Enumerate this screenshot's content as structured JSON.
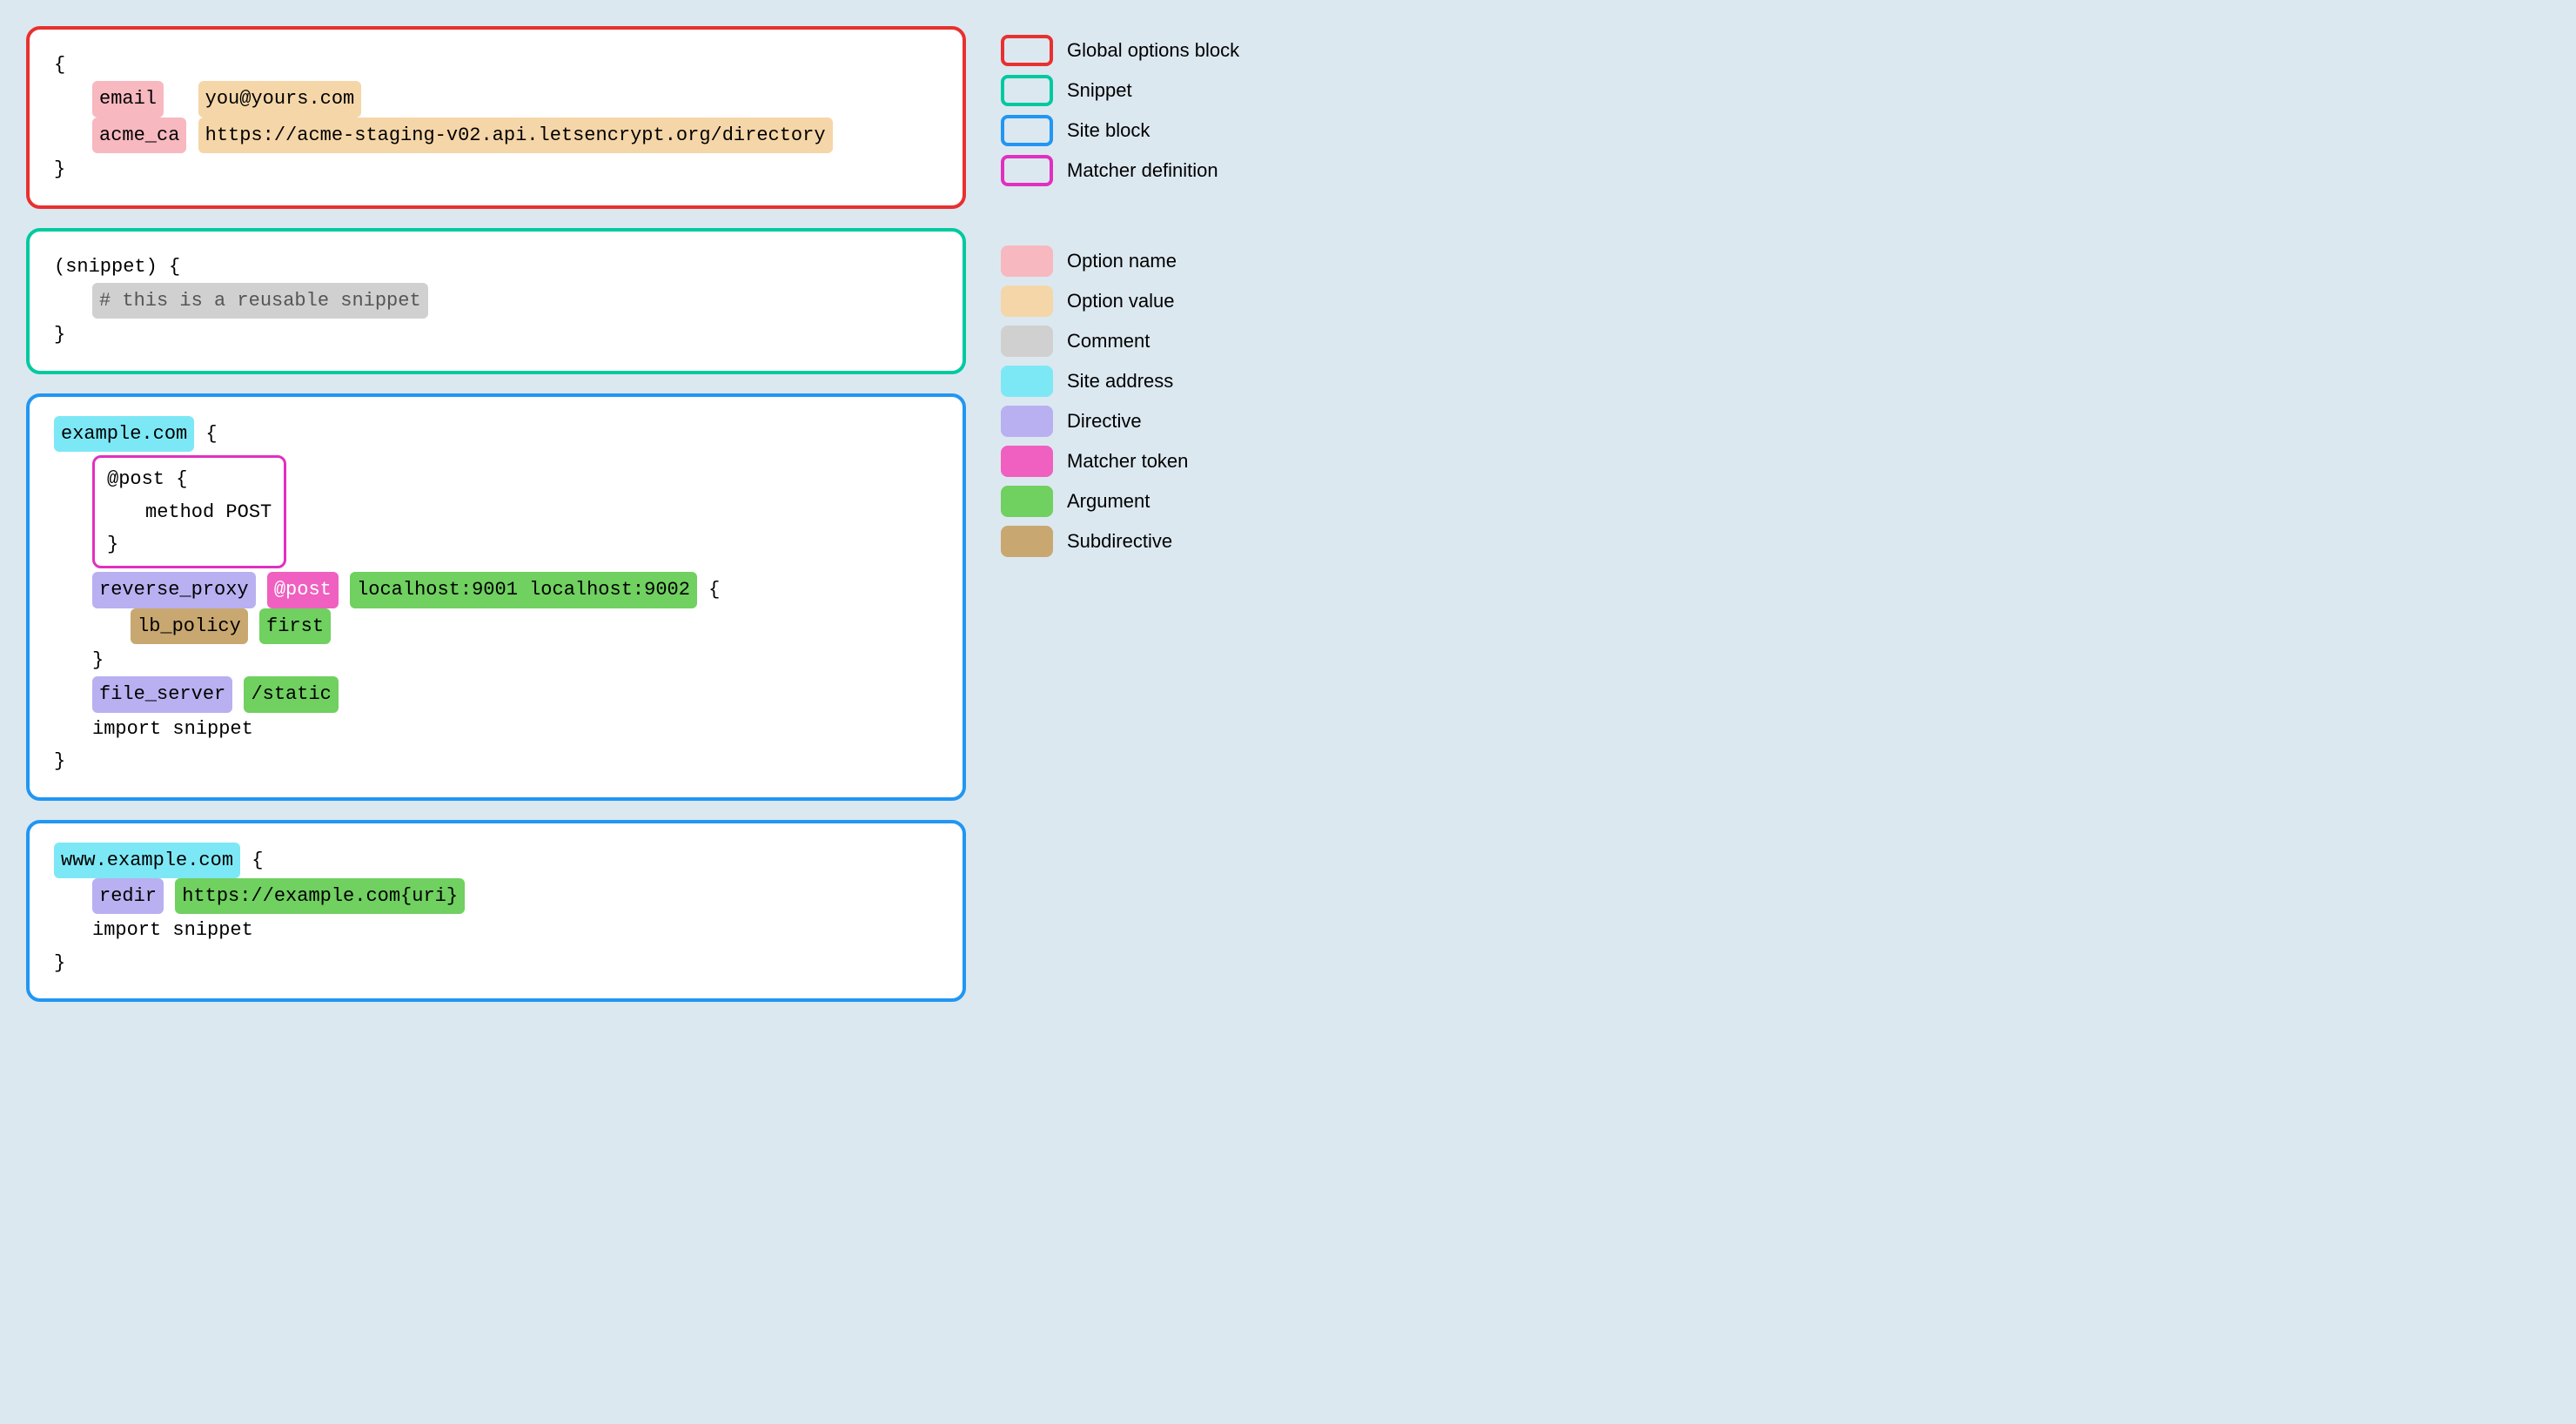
{
  "legend": {
    "border_items": [
      {
        "id": "global-options-block",
        "label": "Global options block",
        "color": "#e83030"
      },
      {
        "id": "snippet",
        "label": "Snippet",
        "color": "#00c9a0"
      },
      {
        "id": "site-block",
        "label": "Site block",
        "color": "#2196f3"
      },
      {
        "id": "matcher-definition",
        "label": "Matcher definition",
        "color": "#e030c0"
      }
    ],
    "fill_items": [
      {
        "id": "option-name",
        "label": "Option name",
        "color": "#f7b8c0"
      },
      {
        "id": "option-value",
        "label": "Option value",
        "color": "#f5d6a8"
      },
      {
        "id": "comment",
        "label": "Comment",
        "color": "#d0d0d0"
      },
      {
        "id": "site-address",
        "label": "Site address",
        "color": "#7de8f5"
      },
      {
        "id": "directive",
        "label": "Directive",
        "color": "#b8b0f0"
      },
      {
        "id": "matcher-token",
        "label": "Matcher token",
        "color": "#f060c0"
      },
      {
        "id": "argument",
        "label": "Argument",
        "color": "#70d060"
      },
      {
        "id": "subdirective",
        "label": "Subdirective",
        "color": "#c8a870"
      }
    ]
  }
}
